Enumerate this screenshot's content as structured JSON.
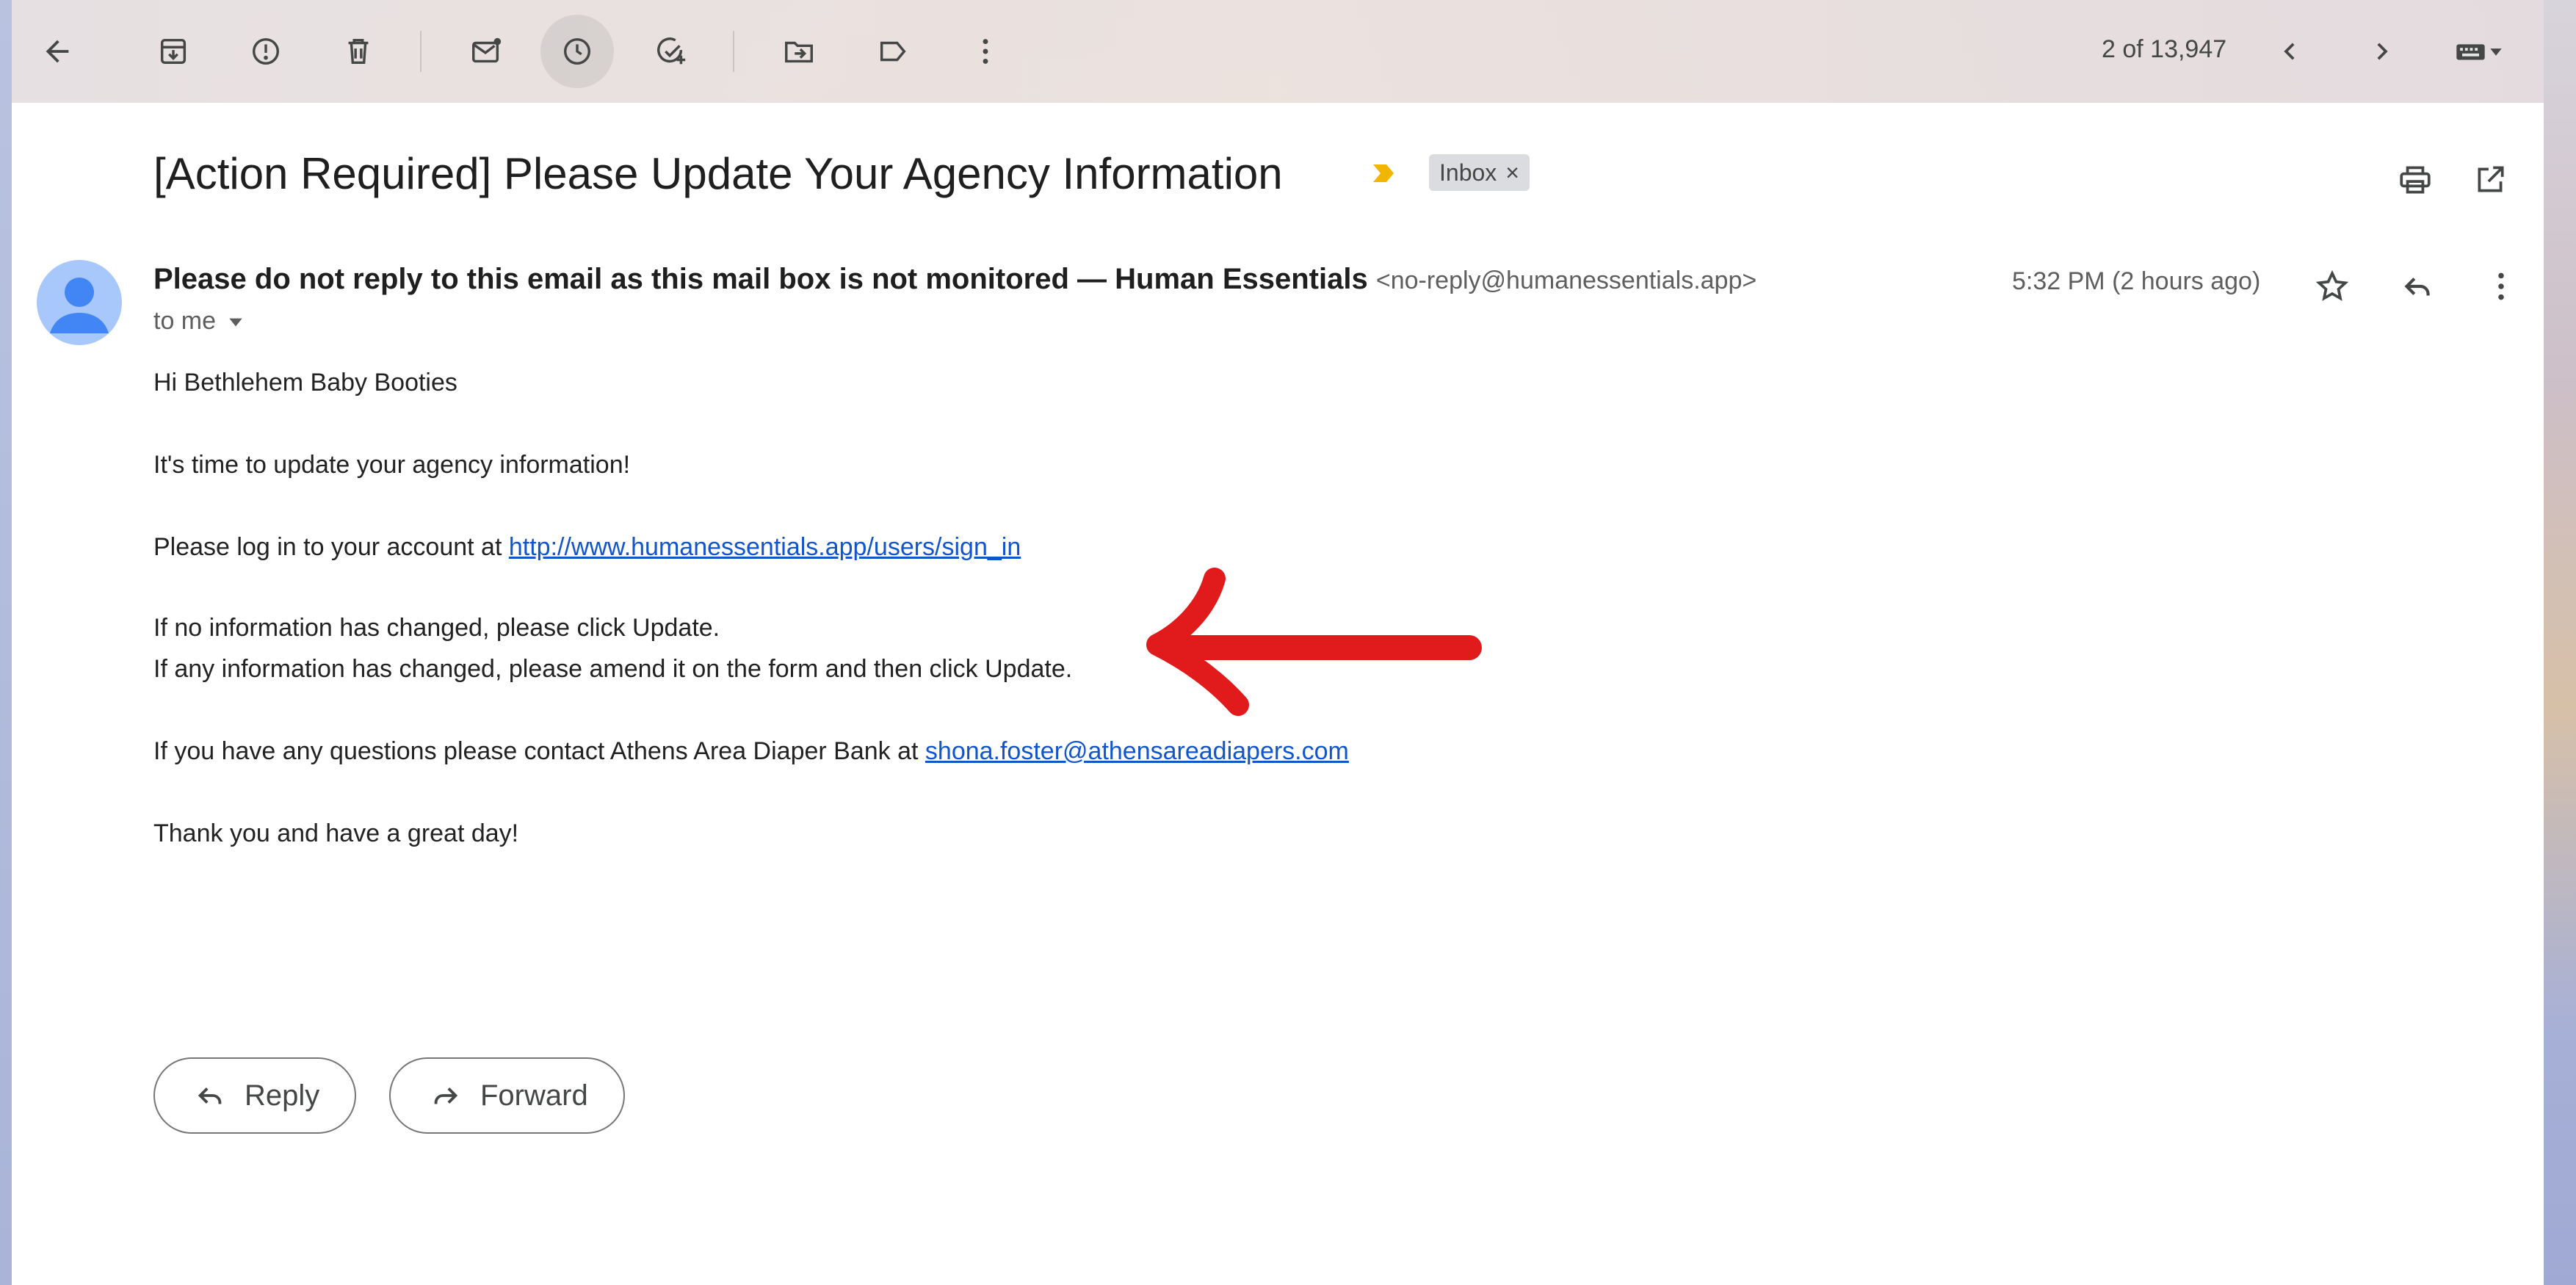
{
  "toolbar": {
    "pager": "2 of 13,947",
    "buttons": [
      "back-icon",
      "archive-icon",
      "report-spam-icon",
      "delete-icon",
      "mark-unread-icon",
      "snooze-icon",
      "add-to-tasks-icon",
      "move-to-icon",
      "label-icon",
      "more-vert-icon",
      "prev-icon",
      "next-icon",
      "input-tools-icon"
    ]
  },
  "email": {
    "subject": "[Action Required] Please Update Your Agency Information",
    "label": "Inbox",
    "label_close": "×",
    "sender_name": "Please do not reply to this email as this mail box is not monitored — Human Essentials",
    "sender_email": "<no-reply@humanessentials.app>",
    "to": "to me",
    "time": "5:32 PM (2 hours ago)",
    "body": {
      "greeting": "Hi Bethlehem Baby Booties",
      "line1": "It's time to update your agency information!",
      "line2_prefix": "Please log in to your account at ",
      "line2_link": "http://www.humanessentials.app/users/sign_in",
      "line3": "If no information has changed, please click Update.",
      "line4": "If any information has changed, please amend it on the form and then click Update.",
      "line5_prefix": "If you have any questions please contact Athens Area Diaper Bank at ",
      "line5_link": "shona.foster@athensareadiapers.com",
      "closing": "Thank you and have a great day!"
    }
  },
  "actions": {
    "reply": "Reply",
    "forward": "Forward"
  },
  "colors": {
    "link": "#1155cc",
    "importance_marker": "#f2b600",
    "annotation_arrow": "#e11b1b"
  }
}
